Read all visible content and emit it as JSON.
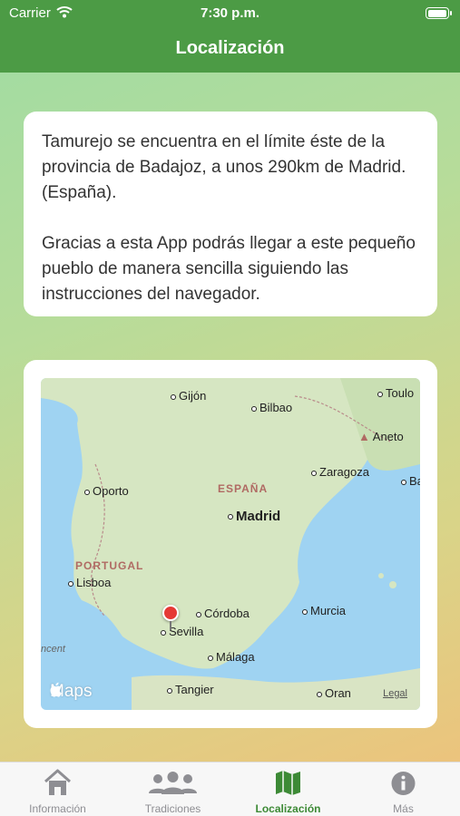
{
  "status_bar": {
    "carrier": "Carrier",
    "time": "7:30 p.m."
  },
  "nav": {
    "title": "Localización"
  },
  "info": {
    "paragraph1": "Tamurejo se encuentra en el límite éste de la provincia de Badajoz, a unos 290km de Madrid. (España).",
    "paragraph2": "Gracias a esta App podrás llegar a este pequeño pueblo de manera sencilla siguiendo las instrucciones del navegador."
  },
  "map": {
    "cities": [
      "Gijón",
      "Bilbao",
      "Toulo",
      "Aneto",
      "Zaragoza",
      "Ba",
      "Oporto",
      "Madrid",
      "Lisboa",
      "Córdoba",
      "Murcia",
      "Sevilla",
      "Málaga",
      "Tangier",
      "Oran",
      "ncent"
    ],
    "countries": [
      "ESPAÑA",
      "PORTUGAL"
    ],
    "logo": "Maps",
    "legal": "Legal"
  },
  "tabs": [
    {
      "label": "Información",
      "icon": "house-icon"
    },
    {
      "label": "Tradiciones",
      "icon": "people-icon"
    },
    {
      "label": "Localización",
      "icon": "map-icon"
    },
    {
      "label": "Más",
      "icon": "info-icon"
    }
  ],
  "colors": {
    "accent": "#4c9b45",
    "active_tab": "#3d8a36"
  }
}
